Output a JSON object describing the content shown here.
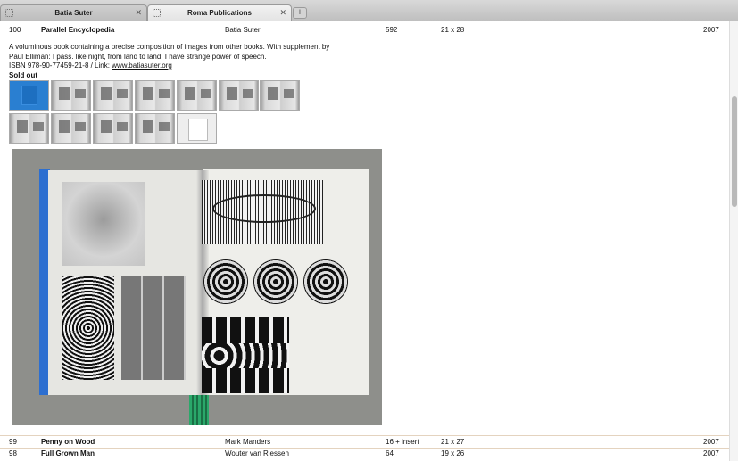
{
  "tabs": [
    {
      "title": "Batia Suter",
      "active": false
    },
    {
      "title": "Roma Publications",
      "active": true
    }
  ],
  "tab_close_glyph": "✕",
  "new_tab_glyph": "+",
  "entries": [
    {
      "number": "100",
      "title": "Parallel Encyclopedia",
      "author": "Batia Suter",
      "pages": "592",
      "size": "21 x 28",
      "year": "2007"
    },
    {
      "number": "99",
      "title": "Penny on Wood",
      "author": "Mark Manders",
      "pages": "16 + insert",
      "size": "21 x 27",
      "year": "2007"
    },
    {
      "number": "98",
      "title": "Full Grown Man",
      "author": "Wouter van Riessen",
      "pages": "64",
      "size": "19 x 26",
      "year": "2007"
    }
  ],
  "detail": {
    "line1": "A voluminous book containing a precise composition of images from other books. With supplement by",
    "line2": "Paul Elliman: I pass. like night, from land to land; I have strange power of speech.",
    "isbn_prefix": "ISBN 978-90-77459-21-8 / Link: ",
    "link_text": "www.batiasuter.org",
    "status": "Sold out"
  },
  "thumbnails_row1_count": 7,
  "thumbnails_row2_count": 5,
  "colors": {
    "row_divider": "#e4d3bf",
    "cover_blue": "#2a7fd1"
  }
}
